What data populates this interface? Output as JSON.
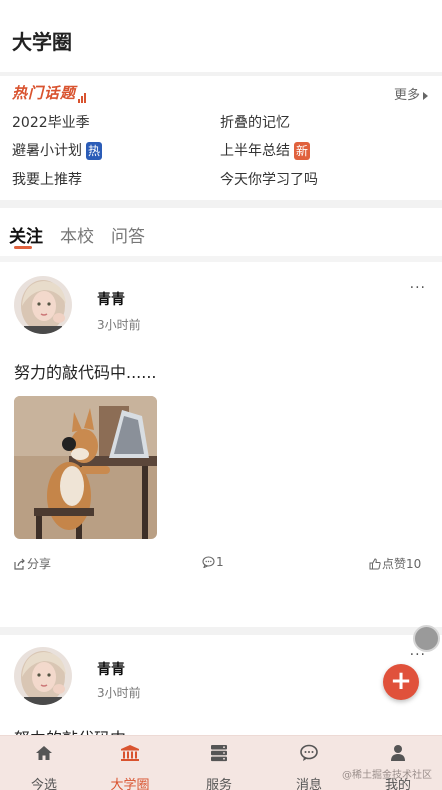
{
  "header": {
    "title": "大学圈"
  },
  "hot_topics": {
    "logo_text": "热门话题",
    "more_label": "更多",
    "items": [
      {
        "label": "2022毕业季",
        "badge": ""
      },
      {
        "label": "折叠的记忆",
        "badge": ""
      },
      {
        "label": "避暑小计划",
        "badge": "热"
      },
      {
        "label": "上半年总结",
        "badge": "新"
      },
      {
        "label": "我要上推荐",
        "badge": ""
      },
      {
        "label": "今天你学习了吗",
        "badge": ""
      }
    ]
  },
  "feed_tabs": [
    {
      "label": "关注",
      "active": true
    },
    {
      "label": "本校",
      "active": false
    },
    {
      "label": "问答",
      "active": false
    }
  ],
  "posts": [
    {
      "author": "青青",
      "time": "3小时前",
      "more": "···",
      "text": "努力的敲代码中......",
      "share_label": "分享",
      "comment_count": "1",
      "like_label": "点赞10"
    },
    {
      "author": "青青",
      "time": "3小时前",
      "more": "···",
      "text": "努力的敲代码中......"
    }
  ],
  "fab": {
    "icon": "plus-icon",
    "label": "+"
  },
  "tabbar": {
    "items": [
      {
        "label": "今选",
        "icon": "home-icon",
        "active": false
      },
      {
        "label": "大学圈",
        "icon": "university-icon",
        "active": true
      },
      {
        "label": "服务",
        "icon": "server-icon",
        "active": false
      },
      {
        "label": "消息",
        "icon": "message-icon",
        "active": false
      },
      {
        "label": "我的",
        "icon": "user-icon",
        "active": false
      }
    ],
    "watermark": "@稀土掘金技术社区"
  },
  "colors": {
    "accent": "#e0613d",
    "hot_badge": "#2b5cb7",
    "tabbar_bg": "#f4e6e2"
  }
}
